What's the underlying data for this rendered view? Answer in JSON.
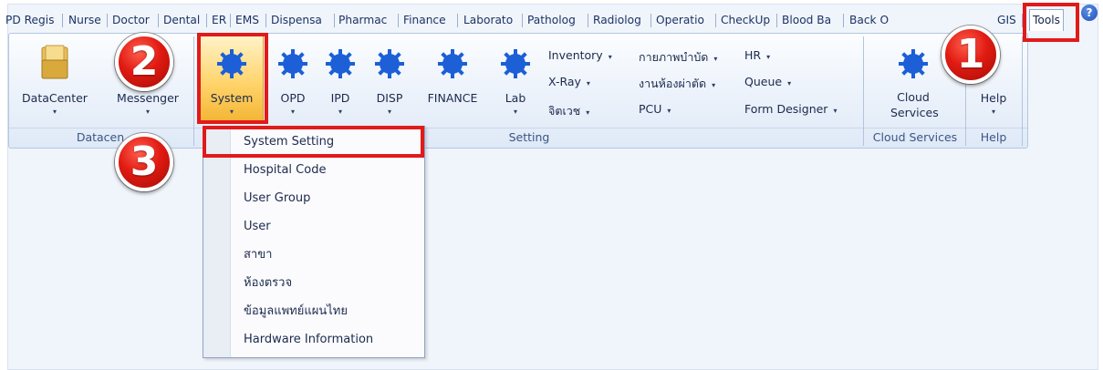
{
  "tabs": [
    {
      "label": "PD Regis"
    },
    {
      "label": "Nurse"
    },
    {
      "label": "Doctor"
    },
    {
      "label": "Dental"
    },
    {
      "label": "ER"
    },
    {
      "label": "EMS"
    },
    {
      "label": "Dispensa"
    },
    {
      "label": "Pharmac"
    },
    {
      "label": "Finance"
    },
    {
      "label": "Laborato"
    },
    {
      "label": "Patholog"
    },
    {
      "label": "Radiolog"
    },
    {
      "label": "Operatio"
    },
    {
      "label": "CheckUp"
    },
    {
      "label": "Blood Ba"
    },
    {
      "label": "Back O"
    },
    {
      "label": "GIS"
    },
    {
      "label": "Tools"
    }
  ],
  "ribbon": {
    "datacenter_group": {
      "label": "Datacen",
      "buttons": {
        "datacenter": "DataCenter",
        "messenger": "Messenger"
      }
    },
    "setting_group": {
      "label": "Setting",
      "buttons": {
        "system": "System",
        "opd": "OPD",
        "ipd": "IPD",
        "disp": "DISP",
        "finance": "FINANCE",
        "lab": "Lab"
      },
      "small_items": {
        "inventory": "Inventory",
        "xray": "X-Ray",
        "jitavej": "จิตเวช",
        "physio": "กายภาพบำบัด",
        "or_room": "งานห้องผ่าตัด",
        "pcu": "PCU",
        "hr": "HR",
        "queue": "Queue",
        "form_designer": "Form Designer"
      }
    },
    "cloud_group": {
      "label": "Cloud Services",
      "button": "Cloud Services"
    },
    "help_group": {
      "label": "Help",
      "button": "Help"
    }
  },
  "system_menu": {
    "items": [
      "System Setting",
      "Hospital Code",
      "User Group",
      "User",
      "สาขา",
      "ห้องตรวจ",
      "ข้อมูลแพทย์แผนไทย",
      "Hardware Information"
    ]
  },
  "badges": {
    "step1": "1",
    "step2": "2",
    "step3": "3"
  },
  "dropdown_arrow": "▾",
  "colors": {
    "highlight_box": "#e11a1a",
    "badge_red": "#e11b12",
    "selected_button": "#ffd46b",
    "gear_blue": "#1c5fd6"
  }
}
